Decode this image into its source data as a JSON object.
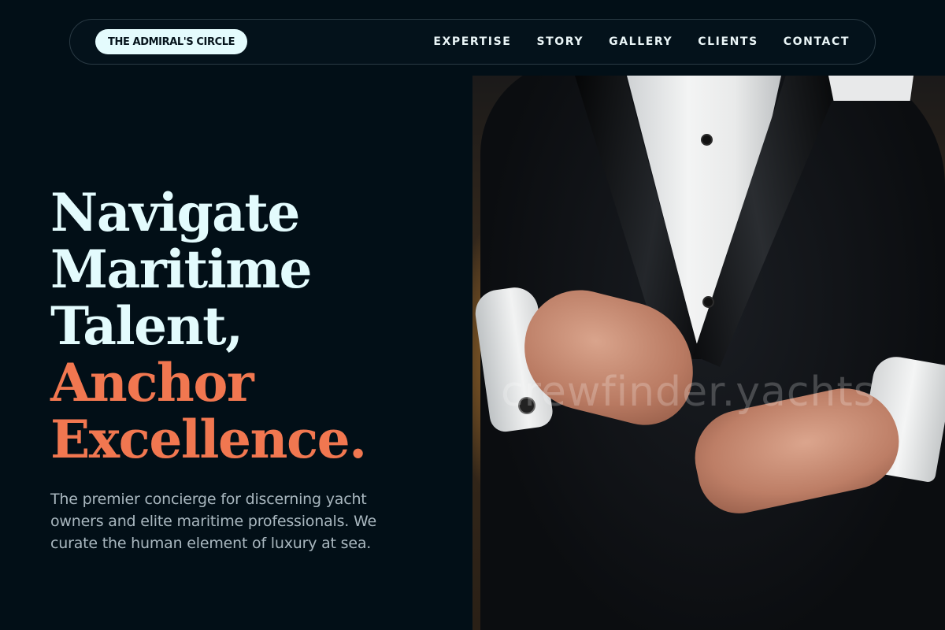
{
  "brand": {
    "logo_label": "THE ADMIRAL'S CIRCLE"
  },
  "nav": {
    "items": [
      {
        "label": "EXPERTISE"
      },
      {
        "label": "STORY"
      },
      {
        "label": "GALLERY"
      },
      {
        "label": "CLIENTS"
      },
      {
        "label": "CONTACT"
      }
    ]
  },
  "hero": {
    "headline_lines": [
      "Navigate",
      "Maritime",
      "Talent,"
    ],
    "accent_lines": [
      "Anchor",
      "Excellence."
    ],
    "subheading": "The premier concierge for discerning yacht owners and elite maritime professionals. We curate the human element of luxury at sea.",
    "image_watermark": "crewfinder.yachts"
  },
  "colors": {
    "background": "#020f17",
    "headline": "#e3fbfd",
    "accent": "#f17750",
    "body_text": "#a9b7bf",
    "logo_pill": "#e4fbfd"
  }
}
